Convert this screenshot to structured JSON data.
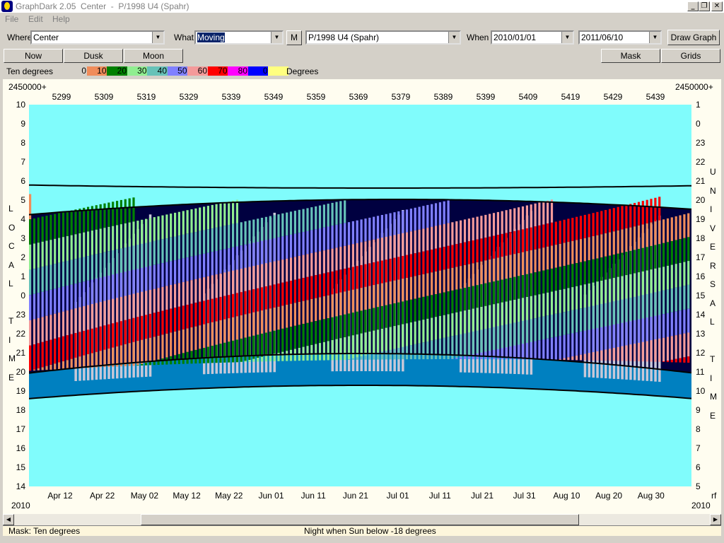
{
  "window": {
    "title": "GraphDark 2.05  Center  -  P/1998 U4 (Spahr)",
    "minimize": "_",
    "restore": "❐",
    "close": "✕"
  },
  "menu": [
    {
      "label": "File"
    },
    {
      "label": "Edit"
    },
    {
      "label": "Help"
    }
  ],
  "toolbar": {
    "where_label": "Where",
    "where_value": "Center",
    "what_label": "What",
    "what_value": "Moving",
    "m_button": "M",
    "object_value": "P/1998 U4 (Spahr)",
    "when_label": "When",
    "date_from": "2010/01/01",
    "date_to": "2011/06/10",
    "draw_button": "Draw Graph"
  },
  "buttons": {
    "now": "Now",
    "dusk": "Dusk",
    "moon": "Moon",
    "mask": "Mask",
    "grids": "Grids"
  },
  "legend": {
    "label": "Ten degrees",
    "units": "Degrees",
    "items": [
      {
        "text": "0",
        "color": "#d4d0c8"
      },
      {
        "text": "10",
        "color": "#f08c5a"
      },
      {
        "text": "20",
        "color": "#008000"
      },
      {
        "text": "30",
        "color": "#90ee90"
      },
      {
        "text": "40",
        "color": "#66c2b8"
      },
      {
        "text": "50",
        "color": "#8080ff"
      },
      {
        "text": "60",
        "color": "#f49a9a"
      },
      {
        "text": "70",
        "color": "#ff0000"
      },
      {
        "text": "80",
        "color": "#ff00ff"
      },
      {
        "text": "0",
        "color": "#0000ff"
      },
      {
        "text": "",
        "color": "#ffff80"
      }
    ]
  },
  "graph": {
    "jd_prefix_left": "2450000+",
    "jd_prefix_right": "2450000+",
    "jd_ticks": [
      "5299",
      "5309",
      "5319",
      "5329",
      "5339",
      "5349",
      "5359",
      "5369",
      "5379",
      "5389",
      "5399",
      "5409",
      "5419",
      "5429",
      "5439"
    ],
    "local_hours": [
      "10",
      "9",
      "8",
      "7",
      "6",
      "5",
      "4",
      "3",
      "2",
      "1",
      "0",
      "23",
      "22",
      "21",
      "20",
      "19",
      "18",
      "17",
      "16",
      "15",
      "14"
    ],
    "ut_hours": [
      "1",
      "0",
      "23",
      "22",
      "21",
      "20",
      "19",
      "18",
      "17",
      "16",
      "15",
      "14",
      "13",
      "12",
      "11",
      "10",
      "9",
      "8",
      "7",
      "6",
      "5"
    ],
    "local_letters": [
      "L",
      "O",
      "C",
      "A",
      "L",
      "",
      "T",
      "I",
      "M",
      "E"
    ],
    "ut_letters": [
      "U",
      "N",
      "I",
      "V",
      "E",
      "R",
      "S",
      "A",
      "L",
      "",
      "T",
      "I",
      "M",
      "E"
    ],
    "dates": [
      "Apr 12",
      "Apr 22",
      "May 02",
      "May 12",
      "May 22",
      "Jun 01",
      "Jun 11",
      "Jun 21",
      "Jul 01",
      "Jul 11",
      "Jul 21",
      "Jul 31",
      "Aug 10",
      "Aug 20",
      "Aug 30"
    ],
    "year_left": "2010",
    "year_right": "2010",
    "rf": "rf",
    "colors": {
      "sky": "#80fcfc",
      "twilight": "#0080c0",
      "night": "#000040",
      "moon": "#c8c8d8"
    }
  },
  "status": {
    "mask": "Mask:  Ten degrees",
    "night": "Night when Sun below -18 degrees"
  }
}
